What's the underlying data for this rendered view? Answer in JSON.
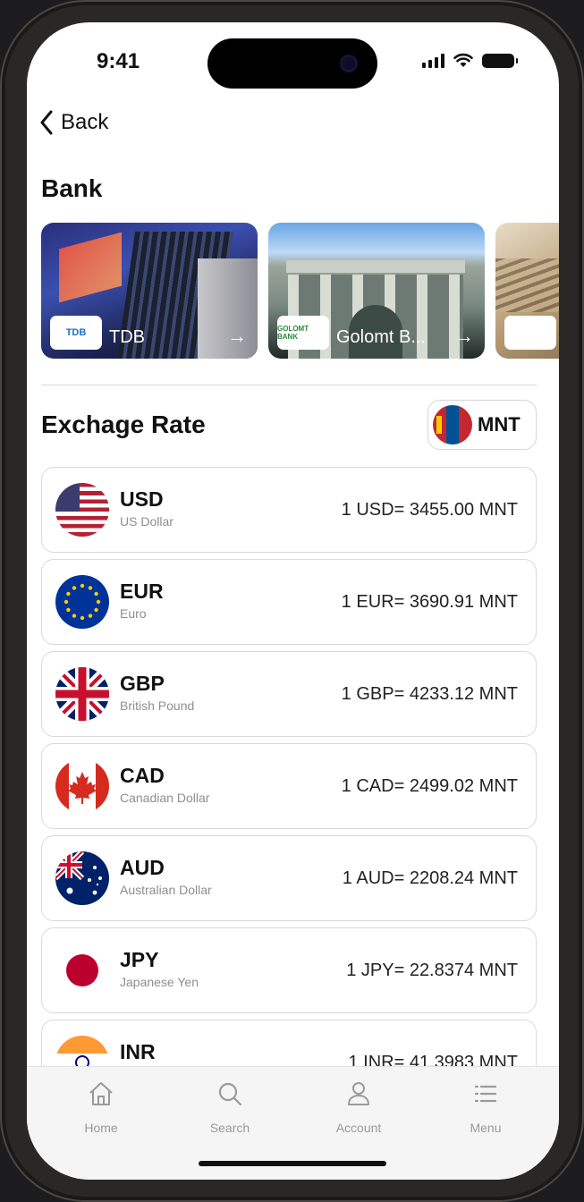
{
  "status_bar": {
    "time": "9:41"
  },
  "nav": {
    "back_label": "Back"
  },
  "bank_section": {
    "title": "Bank",
    "banks": [
      {
        "name": "TDB",
        "logo_text": "TDB"
      },
      {
        "name": "Golomt B...",
        "logo_text": "GOLOMT BANK"
      },
      {
        "name": "",
        "logo_text": ""
      }
    ]
  },
  "exchange_section": {
    "title": "Exchage Rate",
    "base_currency": "MNT",
    "rates": [
      {
        "code": "USD",
        "name": "US Dollar",
        "rate": "1 USD= 3455.00 MNT"
      },
      {
        "code": "EUR",
        "name": "Euro",
        "rate": "1 EUR= 3690.91 MNT"
      },
      {
        "code": "GBP",
        "name": "British Pound",
        "rate": "1 GBP= 4233.12 MNT"
      },
      {
        "code": "CAD",
        "name": "Canadian Dollar",
        "rate": "1 CAD= 2499.02 MNT"
      },
      {
        "code": "AUD",
        "name": "Australian Dollar",
        "rate": "1 AUD= 2208.24 MNT"
      },
      {
        "code": "JPY",
        "name": "Japanese Yen",
        "rate": "1 JPY= 22.8374 MNT"
      },
      {
        "code": "INR",
        "name": "",
        "rate": "1 INR= 41.3983 MNT"
      }
    ]
  },
  "tabbar": {
    "items": [
      {
        "label": "Home",
        "icon": "home-icon"
      },
      {
        "label": "Search",
        "icon": "search-icon"
      },
      {
        "label": "Account",
        "icon": "account-icon"
      },
      {
        "label": "Menu",
        "icon": "menu-icon"
      }
    ]
  },
  "colors": {
    "text_primary": "#111111",
    "text_secondary": "#8e8e8e",
    "card_border": "#d9d9d9",
    "tabbar_bg": "#f5f5f5",
    "tab_inactive": "#9a9a9a"
  }
}
